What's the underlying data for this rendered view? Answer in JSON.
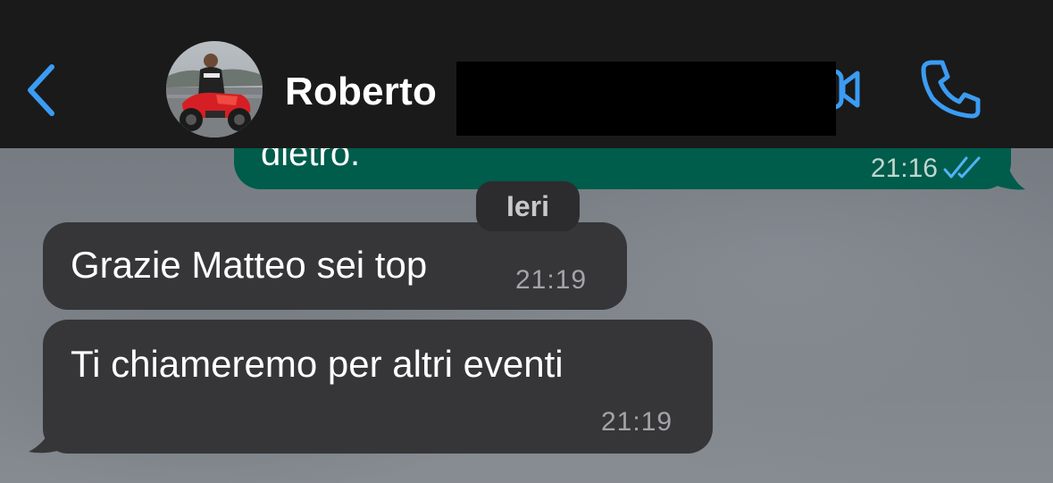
{
  "header": {
    "contact_name": "Roberto",
    "back_icon": "chevron-left-icon",
    "video_icon": "video-camera-icon",
    "call_icon": "phone-icon",
    "avatar": "contact-avatar-photo"
  },
  "messages": {
    "outgoing_partial": {
      "text": "dietro.",
      "time": "21:16",
      "status_icon": "double-check-read-icon"
    },
    "date_separator": "Ieri",
    "incoming": [
      {
        "text": "Grazie Matteo sei top",
        "time": "21:19"
      },
      {
        "text": "Ti chiameremo per altri eventi",
        "time": "21:19"
      }
    ]
  },
  "colors": {
    "header_bg": "#1a1a1a",
    "accent_blue": "#3b9cf3",
    "outgoing_bubble": "#005c4b",
    "incoming_bubble": "#363638",
    "date_pill": "#2c2c2e"
  }
}
